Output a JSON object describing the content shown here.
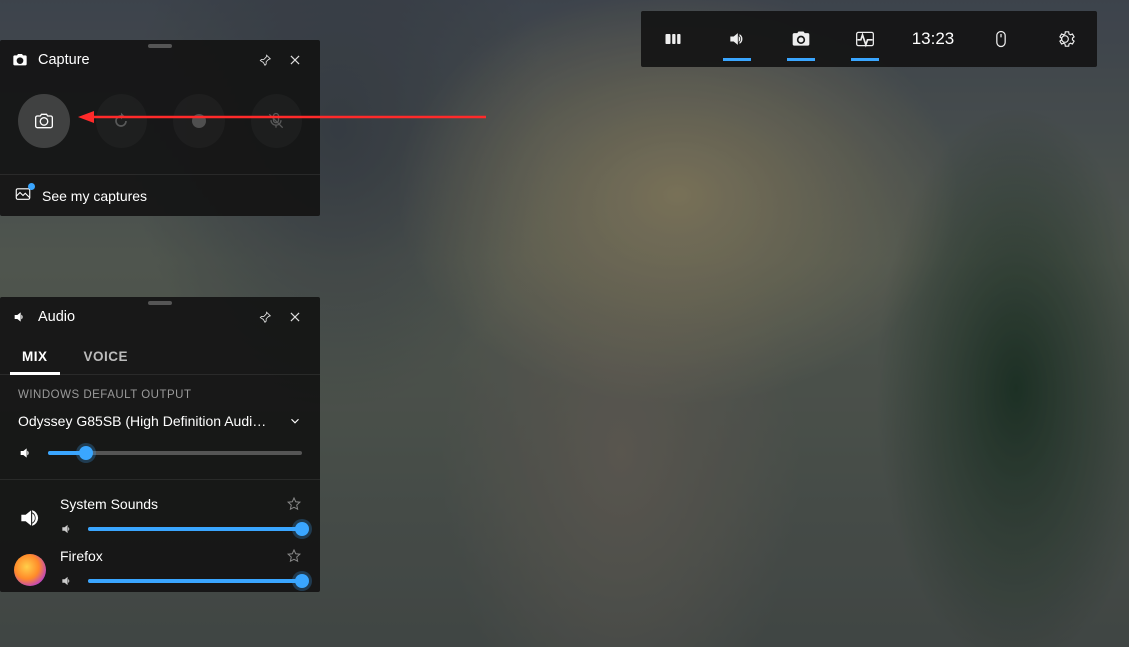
{
  "sysbar": {
    "time": "13:23"
  },
  "capture": {
    "title": "Capture",
    "see_captures": "See my captures"
  },
  "audio": {
    "title": "Audio",
    "tabs": {
      "mix": "MIX",
      "voice": "VOICE"
    },
    "section_label": "WINDOWS DEFAULT OUTPUT",
    "default_device": "Odyssey G85SB (High Definition Audio D...",
    "master_volume_pct": 15,
    "apps": [
      {
        "name": "System Sounds",
        "volume_pct": 100,
        "icon": "sys"
      },
      {
        "name": "Firefox",
        "volume_pct": 100,
        "icon": "ff"
      }
    ]
  },
  "colors": {
    "accent": "#3aa6ff"
  }
}
